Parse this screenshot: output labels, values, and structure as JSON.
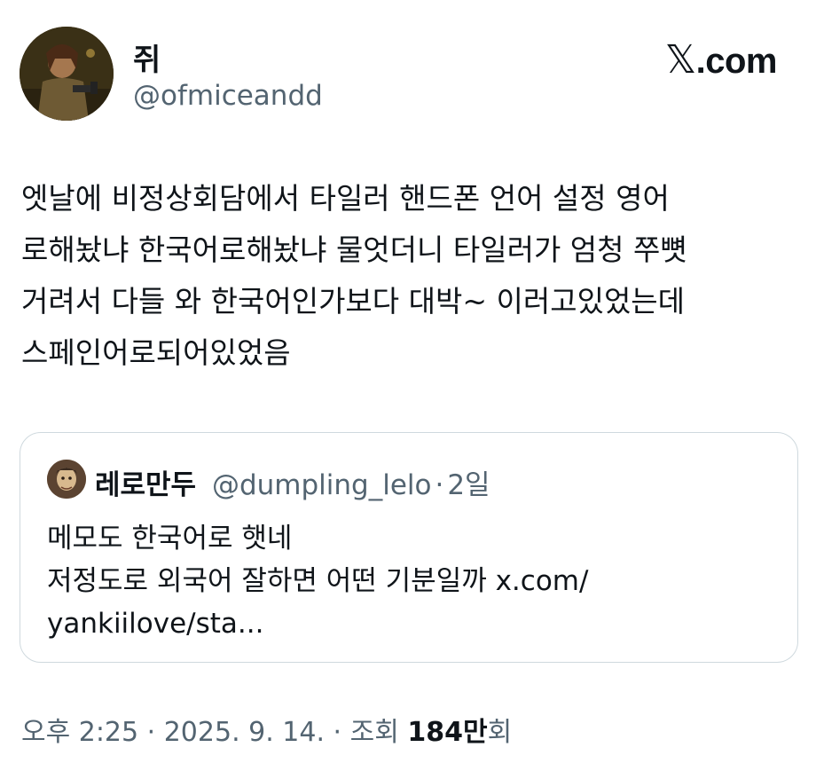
{
  "author": {
    "name": "쥐",
    "handle": "@ofmiceandd"
  },
  "brand": {
    "logo_x": "𝕏",
    "logo_suffix": ".com"
  },
  "tweet": {
    "lines": [
      "엣날에 비정상회담에서 타일러 핸드폰 언어 설정 영어",
      "로해놨냐 한국어로해놨냐 물엇더니 타일러가 엄청 쭈뼛",
      "거려서 다들 와 한국어인가보다 대박~ 이러고있었는데",
      "스페인어로되어있었음"
    ]
  },
  "quoted": {
    "name": "레로만두",
    "handle": "@dumpling_lelo",
    "separator": "·",
    "time": "2일",
    "lines": [
      "메모도 한국어로 햇네",
      "저정도로 외국어 잘하면 어떤 기분일까 x.com/",
      "yankiilove/sta..."
    ]
  },
  "meta": {
    "time": "오후 2:25",
    "sep1": " · ",
    "date": "2025. 9. 14.",
    "sep2": " · ",
    "views_label": "조회 ",
    "views_count": "184만",
    "views_unit": "회"
  }
}
